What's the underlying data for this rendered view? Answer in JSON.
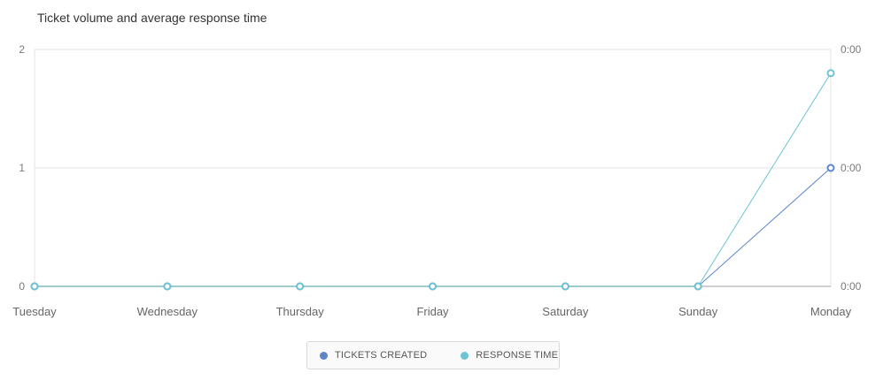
{
  "chart_data": {
    "type": "line",
    "title": "Ticket volume and average response time",
    "categories": [
      "Tuesday",
      "Wednesday",
      "Thursday",
      "Friday",
      "Saturday",
      "Sunday",
      "Monday"
    ],
    "y_left": {
      "ticks": [
        "0",
        "1",
        "2"
      ],
      "ylim": [
        0,
        2
      ]
    },
    "y_right": {
      "ticks": [
        "0:00",
        "0:00",
        "0:00"
      ]
    },
    "series": [
      {
        "name": "TICKETS CREATED",
        "axis": "left",
        "color": "#5b87c8",
        "values": [
          0,
          0,
          0,
          0,
          0,
          0,
          1
        ]
      },
      {
        "name": "RESPONSE TIME",
        "axis": "right",
        "color": "#6cc4d4",
        "values": [
          0,
          0,
          0,
          0,
          0,
          0,
          1.8
        ]
      }
    ],
    "grid": true,
    "legend_position": "bottom-center"
  }
}
